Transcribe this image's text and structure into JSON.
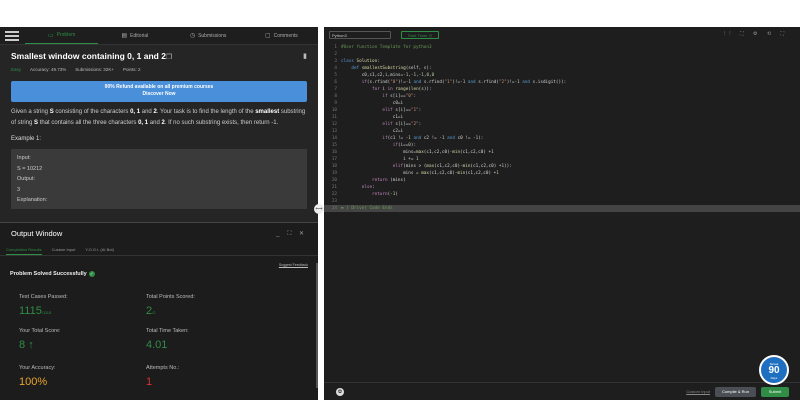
{
  "tabs": [
    {
      "label": "Problem",
      "icon": "▭",
      "active": true
    },
    {
      "label": "Editorial",
      "icon": "▤",
      "active": false
    },
    {
      "label": "Submissions",
      "icon": "◷",
      "active": false
    },
    {
      "label": "Comments",
      "icon": "▢",
      "active": false
    }
  ],
  "problem": {
    "title": "Smallest window containing 0, 1 and 2",
    "copy_icon": "❐",
    "difficulty": "Easy",
    "accuracy": "Accuracy: 49.73%",
    "submissions": "Submissions: 32K+",
    "points": "Points: 2",
    "banner_line1": "90% Refund available on all premium courses",
    "banner_line2": "Discover Now",
    "desc_1": "Given a string ",
    "desc_S1": "S",
    "desc_2": " consisting of the characters ",
    "desc_chars1": "0, 1",
    "desc_3": " and ",
    "desc_chars2": "2",
    "desc_4": ". Your task is to find the length of the ",
    "desc_smallest": "smallest",
    "desc_5": " substring of string ",
    "desc_S2": "S",
    "desc_6": " that contains all the three characters ",
    "desc_chars3": "0, 1",
    "desc_7": " and ",
    "desc_chars4": "2",
    "desc_8": ". If no such substring exists, then return -1.",
    "example_heading": "Example 1:",
    "example_input_label": "Input:",
    "example_input": "S = 10212",
    "example_output_label": "Output:",
    "example_output": "3",
    "example_explanation_label": "Explanation:"
  },
  "output": {
    "title": "Output Window",
    "controls": "_ ⛶ ✕",
    "tabs": [
      "Compilation Results",
      "Custom Input",
      "Y.O.G.I. (AI Bot)"
    ],
    "suggest": "Suggest Feedback",
    "status": "Problem Solved Successfully",
    "test_cases_label": "Test Cases Passed:",
    "test_cases_value": "1115",
    "test_cases_total": "/1115",
    "points_label": "Total Points Scored:",
    "points_value": "2",
    "points_total": "/2",
    "score_label": "Your Total Score:",
    "score_value": "8",
    "score_arrow": "↑",
    "time_label": "Total Time Taken:",
    "time_value": "4.01",
    "accuracy_label": "Your Accuracy:",
    "accuracy_value": "100%",
    "attempts_label": "Attempts No.:",
    "attempts_value": "1"
  },
  "editor": {
    "language": "Python3",
    "timer": "Start Timer ◷",
    "tool_icons": "⁝⁝ ⛶ ⚙ ⟲ ⛶",
    "lines": [
      {
        "n": "1",
        "html": "<span class='cm'>#User function Template for python3</span>"
      },
      {
        "n": "2",
        "html": ""
      },
      {
        "n": "3",
        "html": "<span class='kw'>class</span> <span class='fn'>Solution</span>:"
      },
      {
        "n": "4",
        "html": "    <span class='kw'>def</span> <span class='fn'>smallestSubstring</span>(self, s):"
      },
      {
        "n": "5",
        "html": "        c0,c1,c2,i,mins=-<span class='num'>1</span>,-<span class='num'>1</span>,-<span class='num'>1</span>,<span class='num'>0</span>,<span class='num'>0</span>"
      },
      {
        "n": "6",
        "html": "        <span class='kw2'>if</span>(s.rfind(<span class='str'>\"0\"</span>)!=-<span class='num'>1</span> <span class='kw'>and</span> s.rfind(<span class='str'>\"1\"</span>)!=-<span class='num'>1</span> <span class='kw'>and</span> s.rfind(<span class='str'>\"2\"</span>)!=-<span class='num'>1</span> <span class='kw'>and</span> s.isdigit()):"
      },
      {
        "n": "7",
        "html": "            <span class='kw2'>for</span> i <span class='kw2'>in</span> <span class='fn'>range</span>(<span class='fn'>len</span>(s)):"
      },
      {
        "n": "8",
        "html": "                <span class='kw2'>if</span> s[i]==<span class='str'>\"0\"</span>:"
      },
      {
        "n": "9",
        "html": "                    c0=i"
      },
      {
        "n": "10",
        "html": "                <span class='kw2'>elif</span> s[i]==<span class='str'>\"1\"</span>:"
      },
      {
        "n": "11",
        "html": "                    c1=i"
      },
      {
        "n": "12",
        "html": "                <span class='kw2'>elif</span> s[i]==<span class='str'>\"2\"</span>:"
      },
      {
        "n": "13",
        "html": "                    c2=i"
      },
      {
        "n": "14",
        "html": "                <span class='kw2'>if</span>(c1 != -<span class='num'>1</span> <span class='kw'>and</span> c2 != -<span class='num'>1</span> <span class='kw'>and</span> c0 != -<span class='num'>1</span>):"
      },
      {
        "n": "15",
        "html": "                    <span class='kw2'>if</span>(i==<span class='num'>0</span>):"
      },
      {
        "n": "16",
        "html": "                        mins=<span class='fn'>max</span>(c1,c2,c0)-<span class='fn'>min</span>(c1,c2,c0) +<span class='num'>1</span>"
      },
      {
        "n": "17",
        "html": "                        i += <span class='num'>1</span>"
      },
      {
        "n": "18",
        "html": "                    <span class='kw2'>elif</span>(mins > (<span class='fn'>max</span>(c1,c2,c0)-<span class='fn'>min</span>(c1,c2,c0) +<span class='num'>1</span>)):"
      },
      {
        "n": "19",
        "html": "                        mins = <span class='fn'>max</span>(c1,c2,c0)-<span class='fn'>min</span>(c1,c2,c0) +<span class='num'>1</span>"
      },
      {
        "n": "20",
        "html": "            <span class='kw2'>return</span> (mins)"
      },
      {
        "n": "21",
        "html": "        <span class='kw2'>else</span>:"
      },
      {
        "n": "22",
        "html": "            <span class='kw2'>return</span>(-<span class='num'>1</span>)"
      },
      {
        "n": "23",
        "html": ""
      },
      {
        "n": "24",
        "html": "<span class='cm'>▬ } Driver Code Ends</span>",
        "highlight": true
      }
    ],
    "custom_input": "Custom Input",
    "compile": "Compile & Run",
    "submit": "Submit"
  },
  "badge": {
    "top": "Streak",
    "value": "90",
    "bottom": "Days"
  },
  "colors": {
    "accent": "#2f8d46",
    "banner": "#4a8fd9",
    "score_orange": "#e9a42a",
    "attempts_red": "#e0302f"
  }
}
